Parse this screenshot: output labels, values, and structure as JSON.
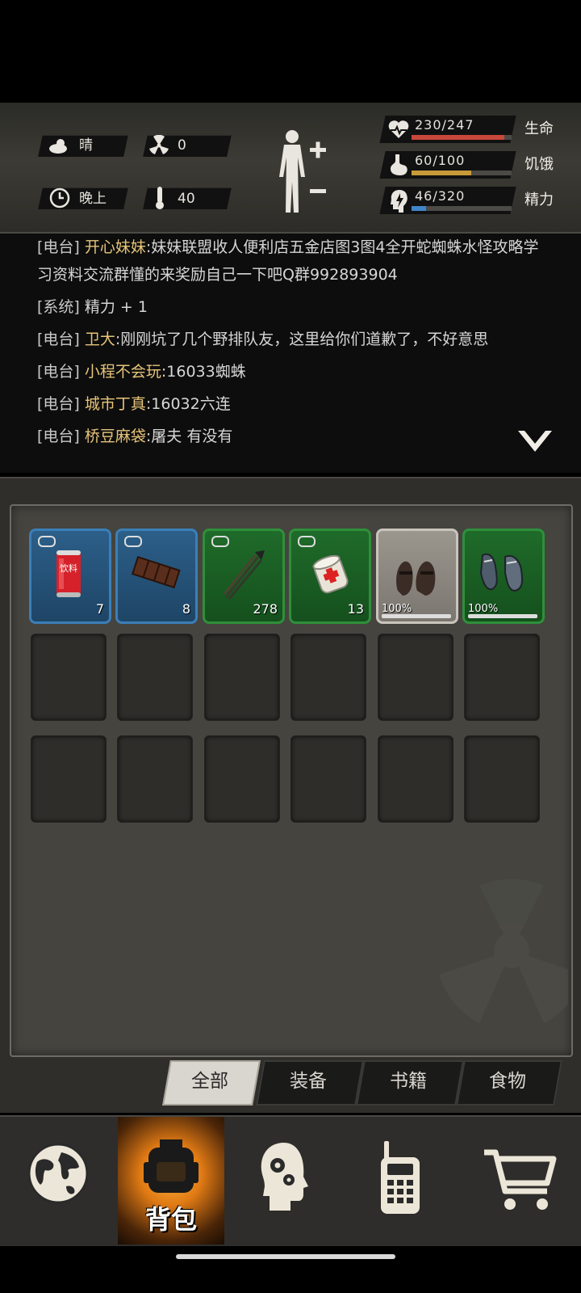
{
  "status": {
    "weather": "晴",
    "radiation": "0",
    "time_of_day": "晚上",
    "temperature": "40",
    "health": {
      "label": "生命",
      "text": "230/247",
      "current": 230,
      "max": 247,
      "color": "#c9473b"
    },
    "hunger": {
      "label": "饥饿",
      "text": "60/100",
      "current": 60,
      "max": 100,
      "color": "#c99a3a"
    },
    "energy": {
      "label": "精力",
      "text": "46/320",
      "current": 46,
      "max": 320,
      "color": "#3f86c8"
    }
  },
  "log": [
    {
      "tag": "[电台]",
      "who": "开心妹妹",
      "msg": ":妹妹联盟收人便利店五金店图3图4全开蛇蜘蛛水怪攻略学习资料交流群懂的来奖励自己一下吧Q群992893904"
    },
    {
      "tag": "[系统]",
      "who": "",
      "msg": "精力 + 1"
    },
    {
      "tag": "[电台]",
      "who": "卫大",
      "msg": ":刚刚坑了几个野排队友，这里给你们道歉了，不好意思"
    },
    {
      "tag": "[电台]",
      "who": "小程不会玩",
      "msg": ":16033蜘蛛"
    },
    {
      "tag": "[电台]",
      "who": "城市丁真",
      "msg": ":16032六连"
    },
    {
      "tag": "[电台]",
      "who": "桥豆麻袋",
      "msg": ":屠夫 有没有"
    }
  ],
  "inventory": {
    "items": [
      {
        "name": "drink-can",
        "icon": "drink-can-icon",
        "can_label": "饮料",
        "count": "7",
        "rarity": "blue"
      },
      {
        "name": "chocolate",
        "icon": "chocolate-icon",
        "count": "8",
        "rarity": "blue"
      },
      {
        "name": "arrows",
        "icon": "arrows-icon",
        "count": "278",
        "rarity": "green"
      },
      {
        "name": "bandage",
        "icon": "bandage-icon",
        "count": "13",
        "rarity": "green"
      },
      {
        "name": "sandals",
        "icon": "sandals-icon",
        "durability": "100%",
        "rarity": "grey"
      },
      {
        "name": "sneakers",
        "icon": "sneakers-icon",
        "durability": "100%",
        "rarity": "green"
      }
    ],
    "tabs": [
      {
        "label": "全部",
        "active": true
      },
      {
        "label": "装备",
        "active": false
      },
      {
        "label": "书籍",
        "active": false
      },
      {
        "label": "食物",
        "active": false
      }
    ]
  },
  "nav": [
    {
      "name": "world-map",
      "icon": "globe-icon",
      "label": ""
    },
    {
      "name": "backpack",
      "icon": "backpack-icon",
      "label": "背包",
      "active": true
    },
    {
      "name": "skills",
      "icon": "head-gears-icon",
      "label": ""
    },
    {
      "name": "radio",
      "icon": "walkie-talkie-icon",
      "label": ""
    },
    {
      "name": "shop",
      "icon": "cart-icon",
      "label": ""
    }
  ]
}
